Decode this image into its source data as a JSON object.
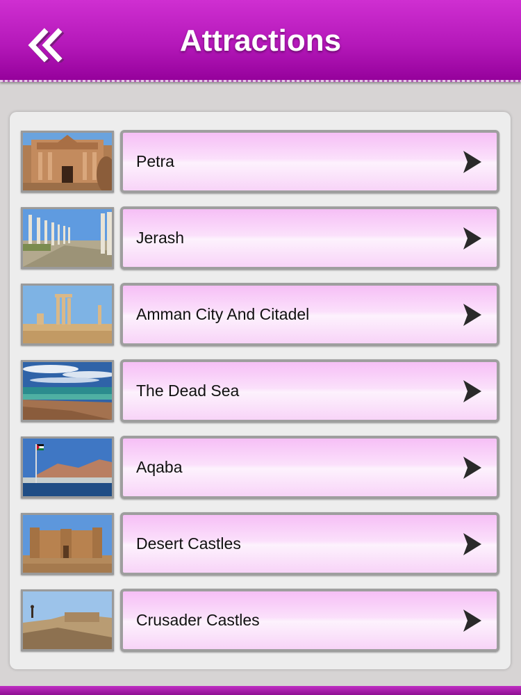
{
  "header": {
    "title": "Attractions",
    "back_icon": "double-chevron-left-icon",
    "colors": {
      "top": "#cf2fd1",
      "bottom": "#94009a"
    }
  },
  "list": {
    "items": [
      {
        "label": "Petra",
        "thumbnail": "petra-monastery-photo",
        "chevron_icon": "chevron-right-icon"
      },
      {
        "label": "Jerash",
        "thumbnail": "jerash-colonnade-photo",
        "chevron_icon": "chevron-right-icon"
      },
      {
        "label": "Amman City And Citadel",
        "thumbnail": "amman-citadel-photo",
        "chevron_icon": "chevron-right-icon"
      },
      {
        "label": "The Dead Sea",
        "thumbnail": "dead-sea-photo",
        "chevron_icon": "chevron-right-icon"
      },
      {
        "label": "Aqaba",
        "thumbnail": "aqaba-harbor-photo",
        "chevron_icon": "chevron-right-icon"
      },
      {
        "label": "Desert Castles",
        "thumbnail": "desert-castle-photo",
        "chevron_icon": "chevron-right-icon"
      },
      {
        "label": "Crusader Castles",
        "thumbnail": "crusader-castle-photo",
        "chevron_icon": "chevron-right-icon"
      }
    ],
    "button_colors": {
      "top": "#f6bff6",
      "middle": "#fdf2fd",
      "border": "#9e9e9e"
    }
  }
}
